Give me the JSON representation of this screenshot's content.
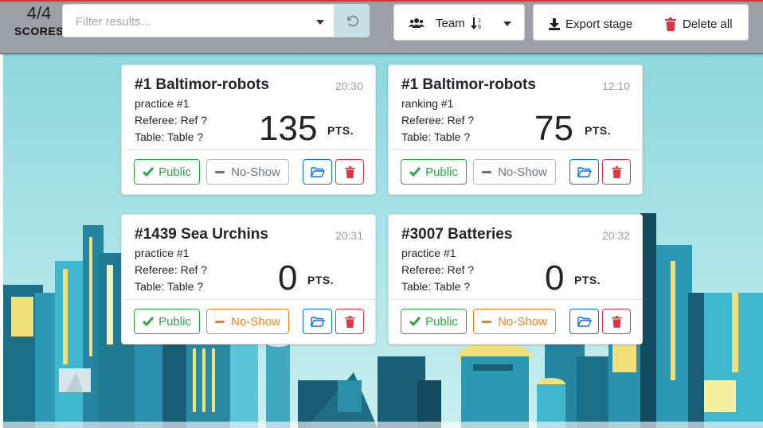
{
  "scores": {
    "count": "4/4",
    "label": "SCORES"
  },
  "filter": {
    "placeholder": "Filter results...",
    "dropdown_icon": "chevron-down-icon",
    "reset_icon": "undo-icon"
  },
  "sort": {
    "label": "Team",
    "icons": [
      "people-icon",
      "sort-descending-icon",
      "chevron-down-icon"
    ]
  },
  "actions": {
    "export_label": "Export stage",
    "delete_label": "Delete all",
    "export_icon": "download-icon",
    "delete_icon": "trash-icon"
  },
  "cards": [
    {
      "title": "#1 Baltimor-robots",
      "time": "20:30",
      "stage": "practice #1",
      "referee": "Referee: Ref ?",
      "table": "Table: Table ?",
      "score": "135",
      "pts": "PTS.",
      "public_label": "Public",
      "noshow_label": "No-Show",
      "noshow_active": false
    },
    {
      "title": "#1 Baltimor-robots",
      "time": "12:10",
      "stage": "ranking #1",
      "referee": "Referee: Ref ?",
      "table": "Table: Table ?",
      "score": "75",
      "pts": "PTS.",
      "public_label": "Public",
      "noshow_label": "No-Show",
      "noshow_active": false
    },
    {
      "title": "#1439 Sea Urchins",
      "time": "20:31",
      "stage": "practice #1",
      "referee": "Referee: Ref ?",
      "table": "Table: Table ?",
      "score": "0",
      "pts": "PTS.",
      "public_label": "Public",
      "noshow_label": "No-Show",
      "noshow_active": true
    },
    {
      "title": "#3007 Batteries",
      "time": "20:32",
      "stage": "practice #1",
      "referee": "Referee: Ref ?",
      "table": "Table: Table ?",
      "score": "0",
      "pts": "PTS.",
      "public_label": "Public",
      "noshow_label": "No-Show",
      "noshow_active": true
    }
  ],
  "colors": {
    "public": "#28a745",
    "noshow_active": "#fd7e14",
    "noshow_inactive": "#6c757d",
    "folder": "#0d6efd",
    "trash": "#dc3545"
  }
}
